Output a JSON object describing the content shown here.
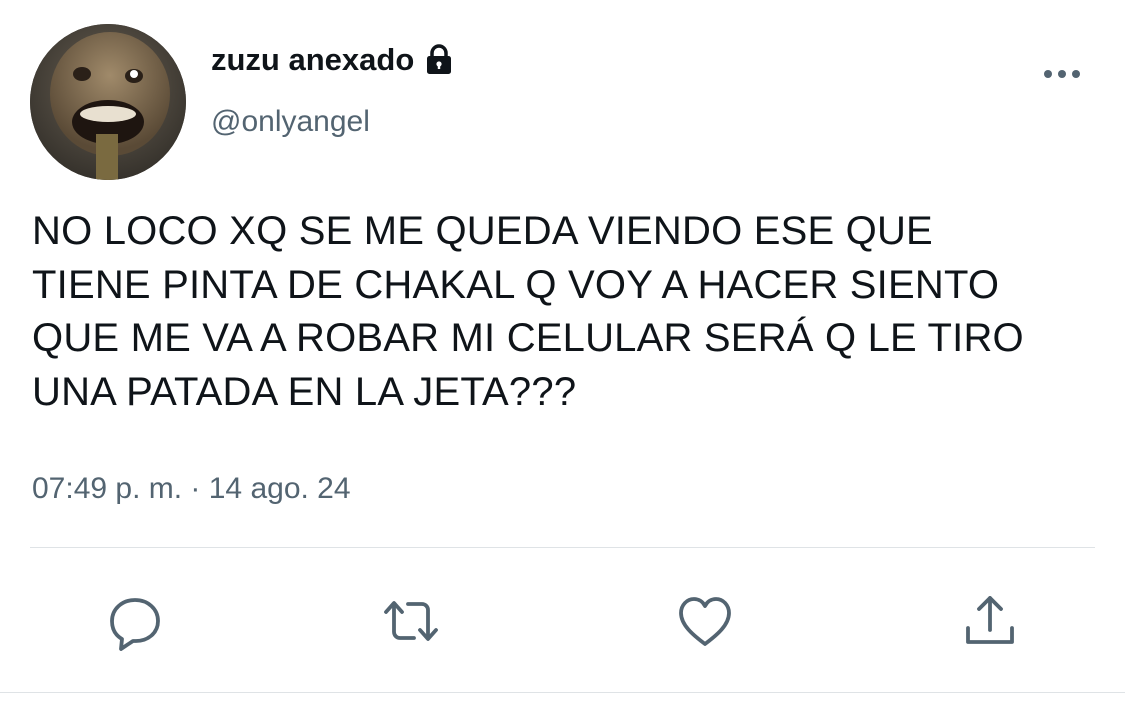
{
  "user": {
    "display_name": "zuzu anexado",
    "handle": "@onlyangel",
    "protected_icon": "lock-icon",
    "avatar_icon": "avatar"
  },
  "tweet": {
    "text": "NO LOCO XQ SE ME QUEDA VIENDO ESE QUE\nTIENE PINTA DE CHAKAL Q VOY A HACER SIENTO\nQUE ME VA A ROBAR MI CELULAR SERÁ Q LE TIRO\nUNA PATADA EN LA JETA???",
    "timestamp": "07:49 p. m. · 14 ago. 24"
  },
  "actions": [
    {
      "name": "reply",
      "icon": "speech-bubble-icon"
    },
    {
      "name": "retweet",
      "icon": "retweet-arrows-icon"
    },
    {
      "name": "like",
      "icon": "heart-icon"
    },
    {
      "name": "share",
      "icon": "share-upload-icon"
    }
  ],
  "menu": {
    "icon": "more-options-icon"
  },
  "colors": {
    "text": "#0f1419",
    "secondary": "#536471",
    "divider": "#dfe3e6",
    "icon": "#536471"
  }
}
